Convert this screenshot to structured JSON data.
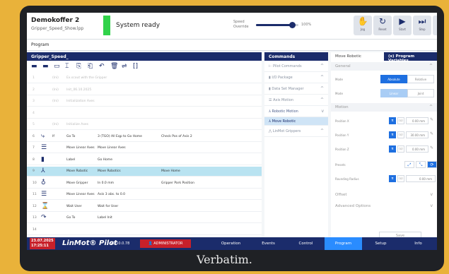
{
  "header": {
    "project_title": "Demokoffer 2",
    "project_subtitle": "Gripper_Speed_Show.lpp",
    "status_text": "System ready",
    "speed_label": "Speed Override",
    "speed_value": "100%",
    "speed_fraction": 0.85,
    "status_color": "#31d24a",
    "toolbar": [
      {
        "icon": "hand-icon",
        "glyph": "✋",
        "label": "Jog"
      },
      {
        "icon": "restart-icon",
        "glyph": "↻",
        "label": "Reset"
      },
      {
        "icon": "play-icon",
        "glyph": "▶",
        "label": "Start"
      },
      {
        "icon": "step-icon",
        "glyph": "⏭",
        "label": "Step"
      },
      {
        "icon": "stop-icon",
        "glyph": "■",
        "label": "Stop"
      }
    ]
  },
  "tabbar": {
    "label": "Program"
  },
  "program": {
    "title": "Gripper_Speed_",
    "toolbar_icons": [
      "folder-icon",
      "folder-open-icon",
      "save-icon",
      "cut-icon",
      "copy-icon",
      "paste-icon",
      "undo-icon",
      "delete-icon",
      "align-icon",
      "bracket-icon"
    ],
    "rows": [
      {
        "n": "1",
        "icon": "",
        "c1": "(Ini)",
        "c2": "Ex.scout with the Gripper",
        "c3": "",
        "c4": "",
        "c5": "",
        "faded": true,
        "sel": false
      },
      {
        "n": "2",
        "icon": "",
        "c1": "(Ini)",
        "c2": "Init_06.10.2025",
        "c3": "",
        "c4": "",
        "c5": "",
        "faded": true,
        "sel": false
      },
      {
        "n": "3",
        "icon": "",
        "c1": "(Ini)",
        "c2": "Initialization Axes",
        "c3": "",
        "c4": "",
        "c5": "",
        "faded": true,
        "sel": false
      },
      {
        "n": "4",
        "icon": "",
        "c1": "",
        "c2": "",
        "c3": "",
        "c4": "",
        "c5": "",
        "faded": true,
        "sel": false
      },
      {
        "n": "5",
        "icon": "",
        "c1": "(Ini)",
        "c2": "Initialize Axes",
        "c3": "",
        "c4": "",
        "c5": "",
        "faded": true,
        "sel": false
      },
      {
        "n": "6",
        "icon": "⤷",
        "c1": "If",
        "c2": "Go To",
        "c3": "3 (TGO) All Eqp to Go Home",
        "c4": "Check Pos of Axis 2",
        "c5": "",
        "faded": false,
        "sel": false
      },
      {
        "n": "7",
        "icon": "☰",
        "c1": "",
        "c2": "Move Linear Axes",
        "c3": "Move Linear Axes",
        "c4": "",
        "c5": "",
        "faded": false,
        "sel": false
      },
      {
        "n": "8",
        "icon": "▮",
        "c1": "",
        "c2": "Label",
        "c3": "Go Home",
        "c4": "",
        "c5": "",
        "faded": false,
        "sel": false
      },
      {
        "n": "9",
        "icon": "⅄",
        "c1": "",
        "c2": "Move Robotic",
        "c3": "Move Robotics",
        "c4": "Move Home",
        "c5": "",
        "faded": false,
        "sel": true
      },
      {
        "n": "10",
        "icon": "♁",
        "c1": "",
        "c2": "Move Gripper",
        "c3": "In 0.0 mm",
        "c4": "Gripper Park Position",
        "c5": "",
        "faded": false,
        "sel": false
      },
      {
        "n": "11",
        "icon": "☰",
        "c1": "",
        "c2": "Move Linear Axes",
        "c3": "Axis 3 abs. to 0.0",
        "c4": "",
        "c5": "",
        "faded": false,
        "sel": false
      },
      {
        "n": "12",
        "icon": "⌛",
        "c1": "",
        "c2": "Wait User",
        "c3": "Wait for User",
        "c4": "",
        "c5": "",
        "faded": false,
        "sel": false
      },
      {
        "n": "13",
        "icon": "↷",
        "c1": "",
        "c2": "Go To",
        "c3": "Label Init",
        "c4": "",
        "c5": "",
        "faded": false,
        "sel": false
      },
      {
        "n": "14",
        "icon": "",
        "c1": "",
        "c2": "",
        "c3": "",
        "c4": "",
        "c5": "",
        "faded": false,
        "sel": false
      }
    ]
  },
  "commands": {
    "title": "Commands",
    "items": [
      {
        "label": "Pilot Commands",
        "chevron": "^",
        "sub": false
      },
      {
        "label": "I/O Package",
        "chevron": "^",
        "sub": false
      },
      {
        "label": "Data Set Manager",
        "chevron": "^",
        "sub": false
      },
      {
        "label": "Axis Motion",
        "chevron": "^",
        "sub": false
      },
      {
        "label": "Robotic Motion",
        "chevron": "v",
        "sub": false
      },
      {
        "label": "Move Robotic",
        "chevron": "",
        "sub": true
      },
      {
        "label": "LinMot Grippers",
        "chevron": "^",
        "sub": false
      }
    ]
  },
  "properties": {
    "tab_command": "Move Robotic",
    "tab_vars": "(x) Program Variables",
    "general": "General",
    "mode_label": "Mode",
    "mode_on": "Absolute",
    "mode_off": "Relative",
    "mode2_label": "Mode",
    "mode2_a": "Linear",
    "mode2_b": "Joint",
    "motion": "Motion",
    "pos_x_label": "Position X",
    "pos_x": "0.00 mm",
    "pos_y_label": "Position Y",
    "pos_y": "30.00 mm",
    "pos_z_label": "Position Z",
    "pos_z": "0.00 mm",
    "presets_label": "Presets",
    "radius_label": "Rounding Radius",
    "radius": "0.00 mm",
    "offset": "Offset",
    "advanced": "Advanced Options",
    "save": "Save"
  },
  "footer": {
    "date": "23.07.2025",
    "time": "17:25:11",
    "product": "LinMot® Pilot",
    "version": "V0.10.0.78",
    "user": "ADMINISTRATOR",
    "tabs": [
      "Operation",
      "Events",
      "Control",
      "Program",
      "Setup",
      "Info"
    ],
    "active_tab": "Program"
  },
  "brand": "Verbatim."
}
